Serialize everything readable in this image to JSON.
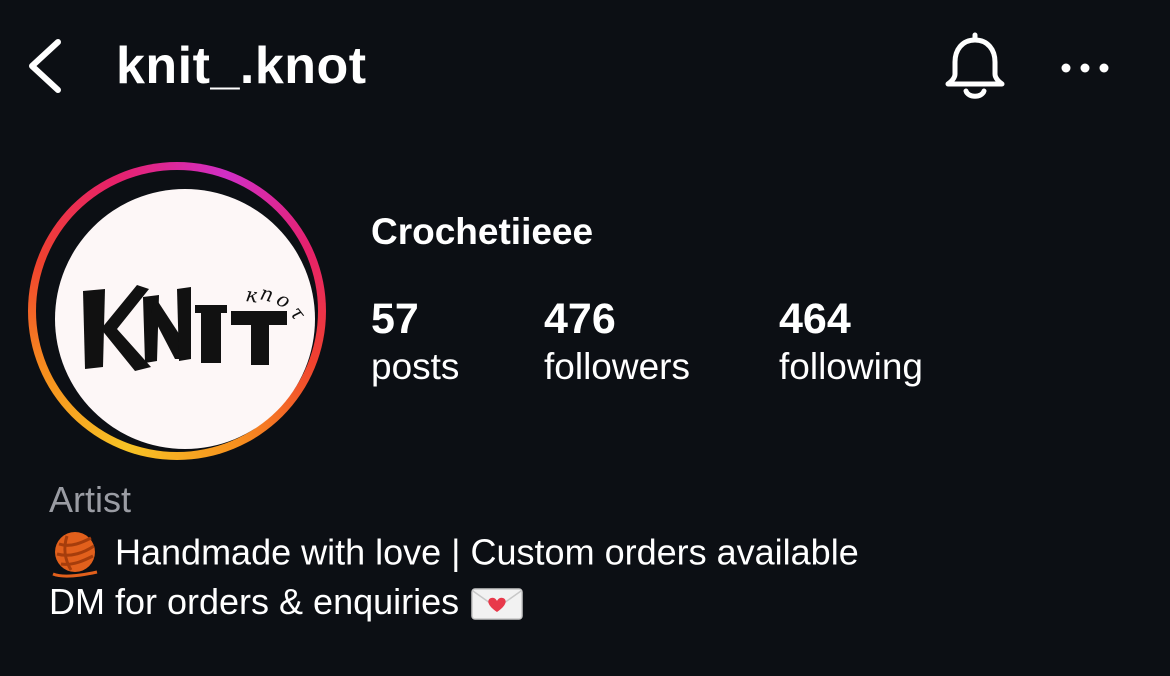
{
  "header": {
    "username": "knit_.knot",
    "icons": [
      "back-chevron-icon",
      "bell-icon",
      "more-horizontal-icon"
    ]
  },
  "profile": {
    "avatar_logo_text": "KNIT KNOT",
    "display_name": "Crochetiieee",
    "ring_colors": [
      "#f7c325",
      "#f78f1e",
      "#f0412f",
      "#e7216b",
      "#d12fc6"
    ],
    "stats": [
      {
        "value": "57",
        "label": "posts"
      },
      {
        "value": "476",
        "label": "followers"
      },
      {
        "value": "464",
        "label": "following"
      }
    ],
    "category": "Artist",
    "bio": [
      {
        "emoji": "yarn-ball-icon",
        "text": "Handmade with love | Custom orders available"
      },
      {
        "text": "DM for orders & enquiries",
        "emoji": "love-letter-icon"
      }
    ]
  },
  "colors": {
    "background": "#0c0f14",
    "text": "#ffffff",
    "muted": "#9a9ca3"
  }
}
